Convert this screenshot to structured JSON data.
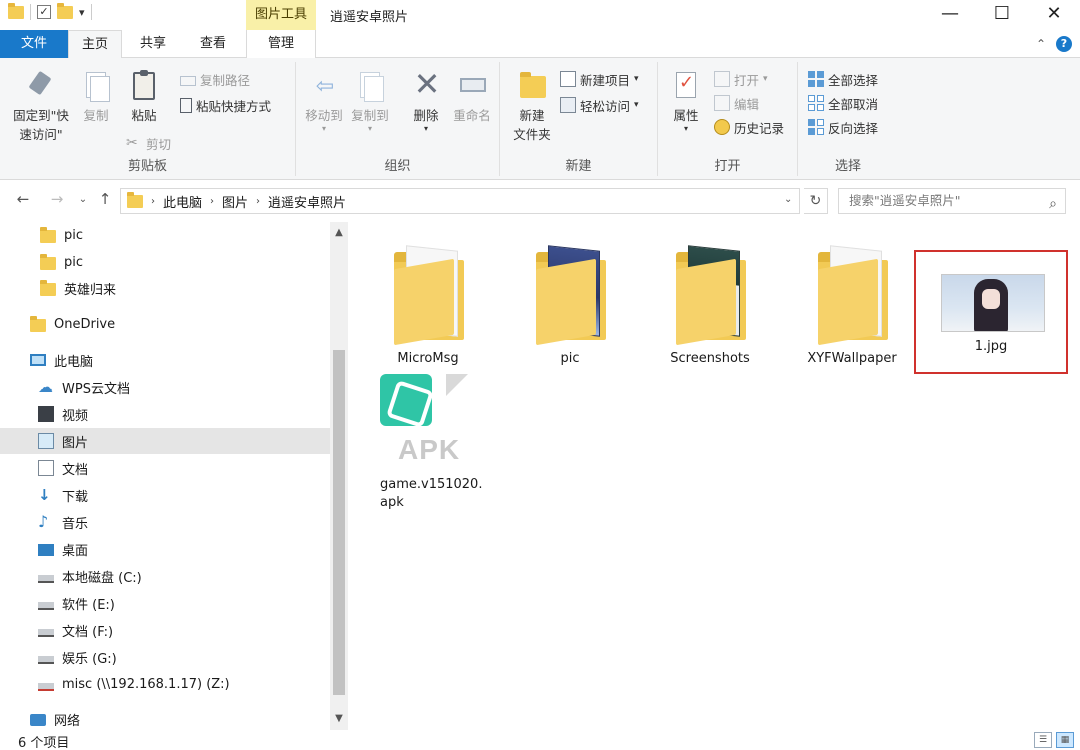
{
  "window": {
    "context_tool": "图片工具",
    "title": "逍遥安卓照片",
    "minimize": "—",
    "maximize": "☐",
    "close": "✕"
  },
  "tabs": {
    "file": "文件",
    "home": "主页",
    "share": "共享",
    "view": "查看",
    "manage": "管理",
    "help": "?"
  },
  "ribbon": {
    "clipboard": {
      "label": "剪贴板",
      "pin_line1": "固定到\"快",
      "pin_line2": "速访问\"",
      "copy": "复制",
      "paste": "粘贴",
      "copy_path": "复制路径",
      "paste_shortcut": "粘贴快捷方式",
      "cut": "剪切"
    },
    "organize": {
      "label": "组织",
      "move_to": "移动到",
      "copy_to": "复制到",
      "delete": "删除",
      "rename": "重命名"
    },
    "new": {
      "label": "新建",
      "new_folder_line1": "新建",
      "new_folder_line2": "文件夹",
      "new_item": "新建项目",
      "easy_access": "轻松访问"
    },
    "open": {
      "label": "打开",
      "properties": "属性",
      "open": "打开",
      "edit": "编辑",
      "history": "历史记录"
    },
    "select": {
      "label": "选择",
      "select_all": "全部选择",
      "select_none": "全部取消",
      "invert": "反向选择"
    }
  },
  "address": {
    "crumbs": [
      "此电脑",
      "图片",
      "逍遥安卓照片"
    ],
    "search_placeholder": "搜索\"逍遥安卓照片\""
  },
  "nav_items": [
    {
      "label": "pic",
      "icon": "folder-icon"
    },
    {
      "label": "pic",
      "icon": "folder-icon"
    },
    {
      "label": "英雄归来",
      "icon": "folder-icon"
    },
    {
      "label": "OneDrive",
      "icon": "folder-icon"
    },
    {
      "label": "此电脑",
      "icon": "computer-icon"
    },
    {
      "label": "WPS云文档",
      "icon": "cloud-icon"
    },
    {
      "label": "视频",
      "icon": "video-icon"
    },
    {
      "label": "图片",
      "icon": "pictures-icon"
    },
    {
      "label": "文档",
      "icon": "documents-icon"
    },
    {
      "label": "下载",
      "icon": "download-icon"
    },
    {
      "label": "音乐",
      "icon": "music-icon"
    },
    {
      "label": "桌面",
      "icon": "desktop-icon"
    },
    {
      "label": "本地磁盘 (C:)",
      "icon": "drive-icon"
    },
    {
      "label": "软件 (E:)",
      "icon": "drive-icon"
    },
    {
      "label": "文档 (F:)",
      "icon": "drive-icon"
    },
    {
      "label": "娱乐 (G:)",
      "icon": "drive-icon"
    },
    {
      "label": "misc (\\\\192.168.1.17) (Z:)",
      "icon": "network-drive-icon"
    },
    {
      "label": "网络",
      "icon": "network-icon"
    }
  ],
  "files": [
    {
      "name": "MicroMsg",
      "type": "folder"
    },
    {
      "name": "pic",
      "type": "folder"
    },
    {
      "name": "Screenshots",
      "type": "folder"
    },
    {
      "name": "XYFWallpaper",
      "type": "folder"
    },
    {
      "name": "1.jpg",
      "type": "image"
    },
    {
      "name_line1": "game.v151020.",
      "name_line2": "apk",
      "type": "apk",
      "badge": "APK"
    }
  ],
  "status": {
    "count": "6 个项目"
  },
  "colors": {
    "accent": "#1979ca",
    "context_tab": "#f9f0a8",
    "selection_box": "#d0312d",
    "folder": "#f4cd55"
  }
}
